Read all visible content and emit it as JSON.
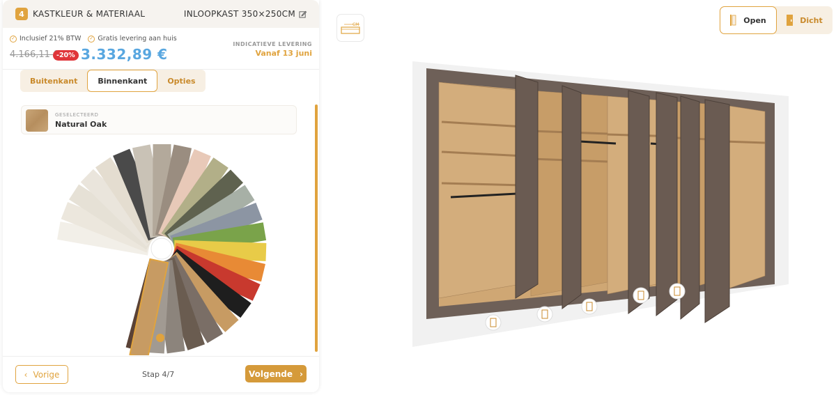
{
  "step": {
    "number": "4",
    "title": "KASTKLEUR & MATERIAAL",
    "wardrobe": "INLOOPKAST 350×250CM"
  },
  "pricing": {
    "vat_note": "Inclusief 21% BTW",
    "shipping_note": "Gratis levering aan huis",
    "old_price": "4.166,11 €",
    "discount": "-20%",
    "new_price": "3.332,89 €",
    "delivery_label": "INDICATIEVE LEVERING",
    "delivery_date": "Vanaf 13 juni"
  },
  "tabs": [
    {
      "label": "Buitenkant",
      "active": false
    },
    {
      "label": "Binnenkant",
      "active": true
    },
    {
      "label": "Opties",
      "active": false
    }
  ],
  "selected": {
    "label": "GESELECTEERD",
    "value": "Natural Oak"
  },
  "swatches": [
    {
      "color": "#f2efe8"
    },
    {
      "color": "#ece7dd"
    },
    {
      "color": "#e6e1d6"
    },
    {
      "color": "#eae5dc"
    },
    {
      "color": "#e4ddd0"
    },
    {
      "color": "#4a4a4a"
    },
    {
      "color": "#c9c2b6"
    },
    {
      "color": "#b3a99b"
    },
    {
      "color": "#9a8d80"
    },
    {
      "color": "#e8c9b8"
    },
    {
      "color": "#b2af88"
    },
    {
      "color": "#5f624f"
    },
    {
      "color": "#a7b0a6"
    },
    {
      "color": "#8c95a3"
    },
    {
      "color": "#7aa34a"
    },
    {
      "color": "#e8cb48"
    },
    {
      "color": "#e88a35"
    },
    {
      "color": "#c8392e"
    },
    {
      "color": "#1e1e1e"
    },
    {
      "color": "#c79b63"
    },
    {
      "color": "#7a6e66"
    },
    {
      "color": "#6a5c50"
    },
    {
      "color": "#8c847c"
    },
    {
      "color": "#a19a92"
    },
    {
      "color": "#5a4236"
    }
  ],
  "footer": {
    "prev": "Vorige",
    "step_count": "Stap 4/7",
    "next": "Volgende"
  },
  "viewer": {
    "logo_text": "CM",
    "open": "Open",
    "closed": "Dicht"
  },
  "colors": {
    "accent": "#e0a33e",
    "price": "#59a7e0",
    "discount": "#e0353a",
    "tab_bg": "#f7efe3"
  },
  "icons": {
    "edit": "edit-icon",
    "check": "check-icon",
    "door": "door-icon",
    "chevron_left": "chevron-left-icon",
    "chevron_right": "chevron-right-icon"
  }
}
